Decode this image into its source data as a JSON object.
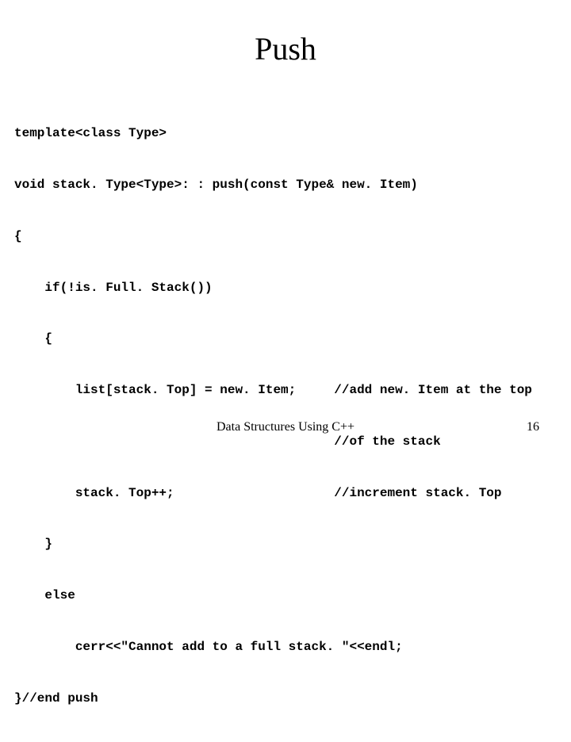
{
  "title": "Push",
  "code_lines": [
    "template<class Type>",
    "void stack. Type<Type>: : push(const Type& new. Item)",
    "{",
    "    if(!is. Full. Stack())",
    "    {",
    "        list[stack. Top] = new. Item;     //add new. Item at the top",
    "                                          //of the stack",
    "        stack. Top++;                     //increment stack. Top",
    "    }",
    "    else",
    "        cerr<<\"Cannot add to a full stack. \"<<endl;",
    "}//end push"
  ],
  "footer_center": "Data Structures Using C++",
  "footer_right": "16"
}
